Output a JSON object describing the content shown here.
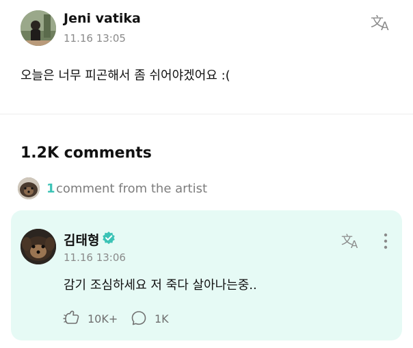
{
  "post": {
    "author": "Jeni vatika",
    "timestamp": "11.16 13:05",
    "body": "오늘은 너무 피곤해서 좀 쉬어야겠어요 :(",
    "translate_icon": "translate-icon"
  },
  "comments_section": {
    "title": "1.2K comments",
    "artist_comment_count": "1",
    "artist_comment_label": "comment from the artist"
  },
  "artist_comment": {
    "author": "김태형",
    "verified_icon": "verified-check-icon",
    "timestamp": "11.16 13:06",
    "body": "감기 조심하세요 저 죽다 살아나는중..",
    "cheer_count": "10K+",
    "reply_count": "1K",
    "card_color": "#e6faf5",
    "accent_color": "#3cc3b6"
  }
}
